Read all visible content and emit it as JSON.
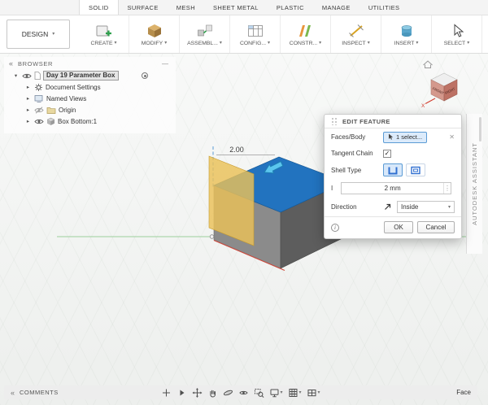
{
  "ui": {
    "caret_down": "▾",
    "caret_right": "▸",
    "collapse": "«",
    "minimize": "—",
    "check": "✓",
    "close": "✕",
    "stepper": "⋮",
    "info": "i"
  },
  "tabs": {
    "items": [
      "SOLID",
      "SURFACE",
      "MESH",
      "SHEET METAL",
      "PLASTIC",
      "MANAGE",
      "UTILITIES"
    ],
    "active": "SOLID"
  },
  "design_menu": {
    "label": "DESIGN"
  },
  "toolbar": {
    "groups": [
      {
        "label": "CREATE"
      },
      {
        "label": "MODIFY"
      },
      {
        "label": "ASSEMBL..."
      },
      {
        "label": "CONFIG..."
      },
      {
        "label": "CONSTR..."
      },
      {
        "label": "INSPECT"
      },
      {
        "label": "INSERT"
      },
      {
        "label": "SELECT"
      }
    ]
  },
  "browser": {
    "title": "BROWSER",
    "root_label": "Day 19 Parameter Box",
    "items": [
      {
        "label": "Document Settings"
      },
      {
        "label": "Named Views"
      },
      {
        "label": "Origin"
      },
      {
        "label": "Box Bottom:1"
      }
    ]
  },
  "viewport": {
    "dimension_label": "2.00",
    "viewcube": {
      "front": "FRONT",
      "right": "RIGHT",
      "axis_x": "X"
    }
  },
  "dialog": {
    "title": "EDIT FEATURE",
    "faces_label": "Faces/Body",
    "faces_value": "1 select...",
    "tangent_label": "Tangent Chain",
    "shell_type_label": "Shell Type",
    "thickness_label": "I",
    "thickness_value": "2 mm",
    "direction_label": "Direction",
    "direction_value": "Inside",
    "ok_label": "OK",
    "cancel_label": "Cancel"
  },
  "assistant": {
    "label": "AUTODESK ASSISTANT"
  },
  "statusbar": {
    "comments_label": "COMMENTS",
    "selection_type": "Face"
  },
  "colors": {
    "accent_blue": "#2273bf",
    "face_highlight": "#eac158",
    "selection_outline": "#5b9bd5"
  }
}
